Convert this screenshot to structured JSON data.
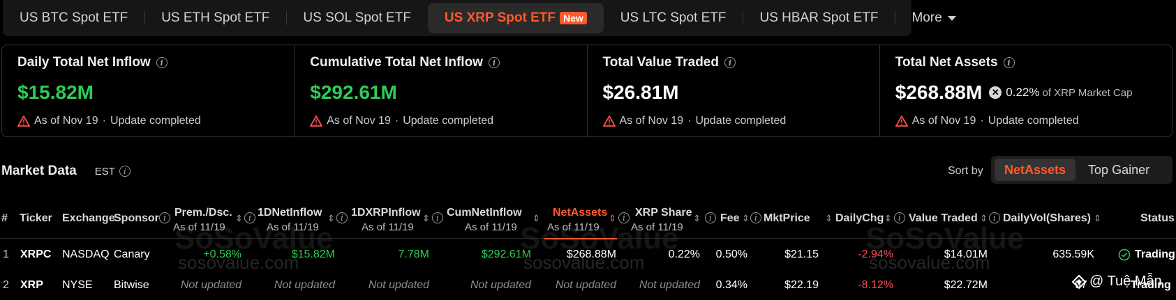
{
  "tabs": [
    {
      "label": "US BTC Spot ETF"
    },
    {
      "label": "US ETH Spot ETF"
    },
    {
      "label": "US SOL Spot ETF"
    },
    {
      "label": "US XRP Spot ETF",
      "badge": "New",
      "active": true
    },
    {
      "label": "US LTC Spot ETF"
    },
    {
      "label": "US HBAR Spot ETF"
    }
  ],
  "more_label": "More",
  "cards": [
    {
      "title": "Daily Total Net Inflow",
      "value": "$15.82M",
      "date": "As of Nov 19",
      "sep": "·",
      "status": "Update completed"
    },
    {
      "title": "Cumulative Total Net Inflow",
      "value": "$292.61M",
      "date": "As of Nov 19",
      "sep": "·",
      "status": "Update completed"
    },
    {
      "title": "Total Value Traded",
      "value": "$26.81M",
      "date": "As of Nov 19",
      "sep": "·",
      "status": "Update completed"
    },
    {
      "title": "Total Net Assets",
      "value": "$268.88M",
      "pct": "0.22%",
      "pct_suffix": "of XRP Market Cap",
      "date": "As of Nov 19",
      "sep": "·",
      "status": "Update completed"
    }
  ],
  "market": {
    "title": "Market Data",
    "tz": "EST",
    "sort_label": "Sort by",
    "sort_options": [
      "NetAssets",
      "Top Gainer"
    ]
  },
  "headers": {
    "num": "#",
    "ticker": "Ticker",
    "exchange": "Exchange",
    "sponsor": "Sponsor",
    "prem": "Prem./Dsc.",
    "prem_sub": "As of 11/19",
    "d1": "1DNetInflow",
    "d1_sub": "As of 11/19",
    "d1x": "1DXRPInflow",
    "d1x_sub": "As of 11/19",
    "cum": "CumNetInflow",
    "cum_sub": "As of 11/19",
    "net": "NetAssets",
    "net_sub": "As of 11/19",
    "share": "XRP Share",
    "share_sub": "As of 11/19",
    "fee": "Fee",
    "mkt": "MktPrice",
    "chg": "DailyChg",
    "vt": "Value Traded",
    "vol": "DailyVol(Shares)",
    "status": "Status"
  },
  "rows": [
    {
      "n": "1",
      "ticker": "XRPC",
      "exchange": "NASDAQ",
      "sponsor": "Canary",
      "prem": "+0.58%",
      "d1": "$15.82M",
      "d1x": "7.78M",
      "cum": "$292.61M",
      "net": "$268.88M",
      "share": "0.22%",
      "fee": "0.50%",
      "mkt": "$21.15",
      "chg": "-2.94%",
      "vt": "$14.01M",
      "vol": "635.59K",
      "status": "Trading"
    },
    {
      "n": "2",
      "ticker": "XRP",
      "exchange": "NYSE",
      "sponsor": "Bitwise",
      "prem": "Not updated",
      "d1": "Not updated",
      "d1x": "Not updated",
      "cum": "Not updated",
      "net": "Not updated",
      "share": "Not updated",
      "fee": "0.34%",
      "mkt": "$22.19",
      "chg": "-8.12%",
      "vt": "$22.72M",
      "vol": "97",
      "status": "Trading"
    }
  ],
  "watermark": {
    "brand": "SoSoValue",
    "url": "sosovalue.com",
    "corner": "@ Tuệ Mẫn"
  },
  "colors": {
    "accent": "#ff5a2c",
    "positive": "#2ecc55",
    "negative": "#ff4d4f"
  }
}
